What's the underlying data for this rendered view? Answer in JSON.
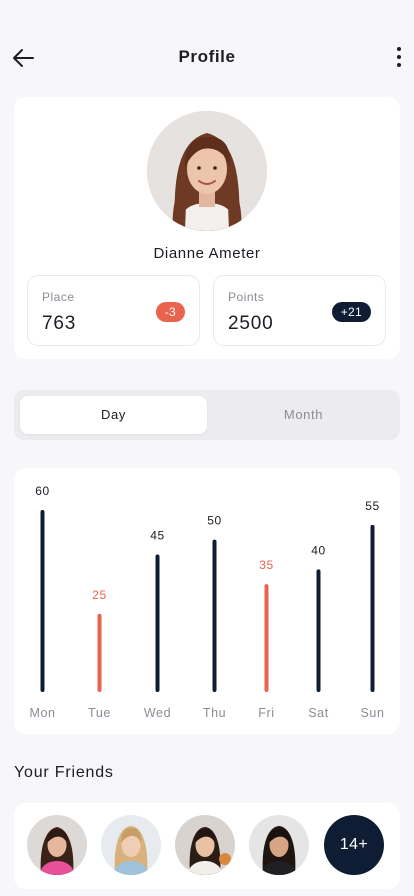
{
  "header": {
    "title": "Profile",
    "back_icon": "arrow-left-icon",
    "menu_icon": "more-vertical-icon"
  },
  "profile": {
    "name": "Dianne Ameter",
    "place": {
      "label": "Place",
      "value": "763",
      "change": "-3"
    },
    "points": {
      "label": "Points",
      "value": "2500",
      "change": "+21"
    }
  },
  "period_toggle": {
    "options": [
      "Day",
      "Month"
    ],
    "selected": "Day"
  },
  "colors": {
    "dark": "#0e1d33",
    "accent": "#e8644c",
    "muted": "#8c8c96"
  },
  "chart_data": {
    "type": "bar",
    "categories": [
      "Mon",
      "Tue",
      "Wed",
      "Thu",
      "Fri",
      "Sat",
      "Sun"
    ],
    "values": [
      60,
      25,
      45,
      50,
      35,
      40,
      55
    ],
    "highlighted": [
      "Tue",
      "Fri"
    ],
    "ylim": [
      0,
      60
    ],
    "grid": false,
    "data_labels": true
  },
  "friends": {
    "title": "Your Friends",
    "avatars": [
      "friend-1",
      "friend-2",
      "friend-3",
      "friend-4"
    ],
    "more_label": "14+"
  }
}
